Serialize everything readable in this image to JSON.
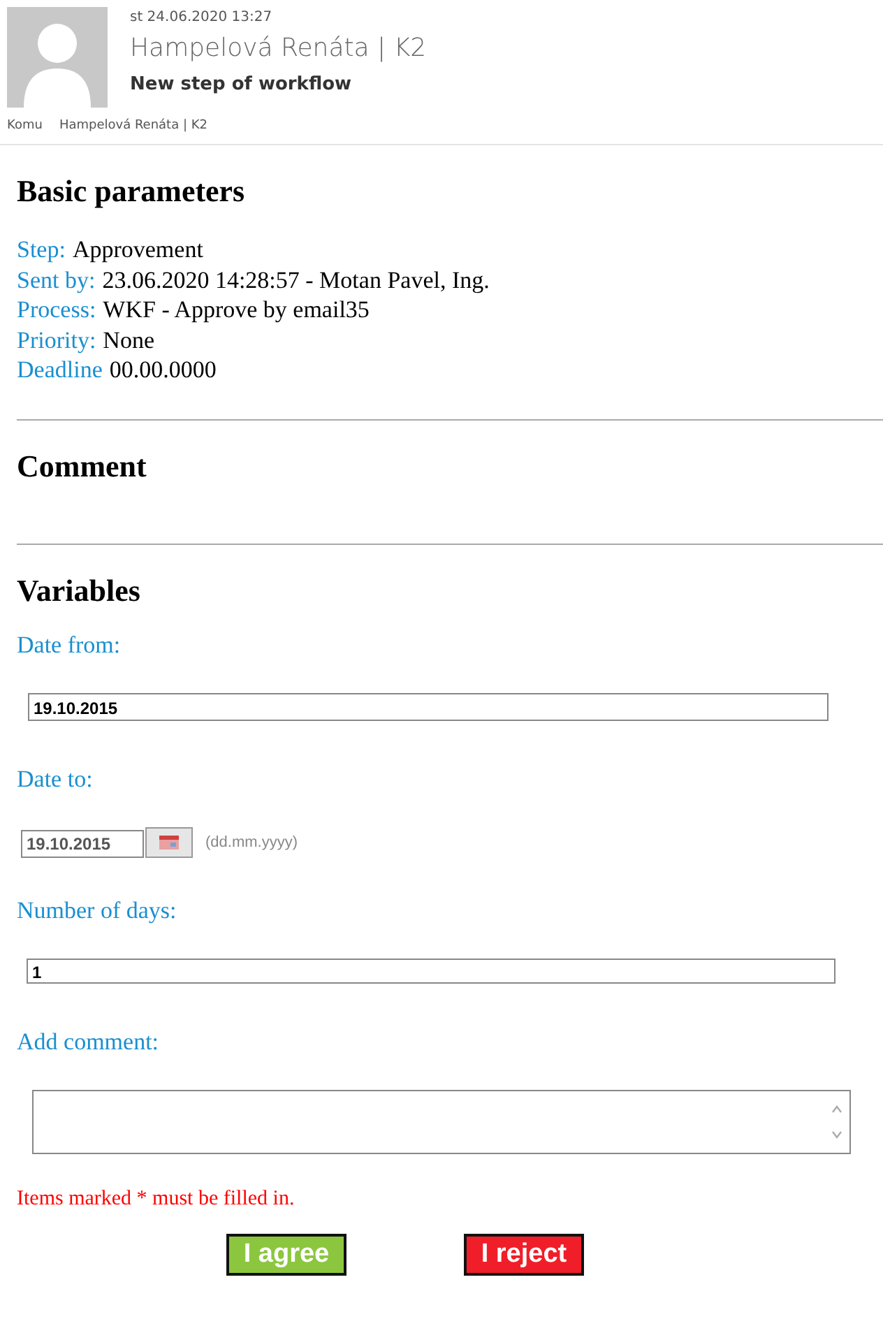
{
  "header": {
    "date": "st 24.06.2020 13:27",
    "sender": "Hampelová Renáta | K2",
    "subject": "New step of workflow",
    "to_label": "Komu",
    "to": "Hampelová Renáta | K2"
  },
  "basic": {
    "title": "Basic parameters",
    "params": [
      {
        "label": "Step:",
        "value": "Approvement"
      },
      {
        "label": "Sent by:",
        "value": "23.06.2020 14:28:57 - Motan Pavel, Ing."
      },
      {
        "label": "Process:",
        "value": "WKF - Approve by email35"
      },
      {
        "label": "Priority:",
        "value": "None"
      },
      {
        "label": "Deadline",
        "value": "00.00.0000"
      }
    ]
  },
  "comment": {
    "title": "Comment"
  },
  "variables": {
    "title": "Variables",
    "fields": [
      {
        "kind": "text",
        "label": "Date from:",
        "value": "19.10.2015"
      },
      {
        "kind": "date",
        "label": "Date to:",
        "value": "19.10.2015",
        "hint": "(dd.mm.yyyy)"
      },
      {
        "kind": "text",
        "label": "Number of days:",
        "value": "1"
      },
      {
        "kind": "textarea",
        "label": "Add comment:"
      }
    ]
  },
  "required_note": "Items marked * must be filled in.",
  "buttons": [
    {
      "kind": "agree",
      "label": "I agree"
    },
    {
      "kind": "reject",
      "label": "I reject"
    }
  ]
}
